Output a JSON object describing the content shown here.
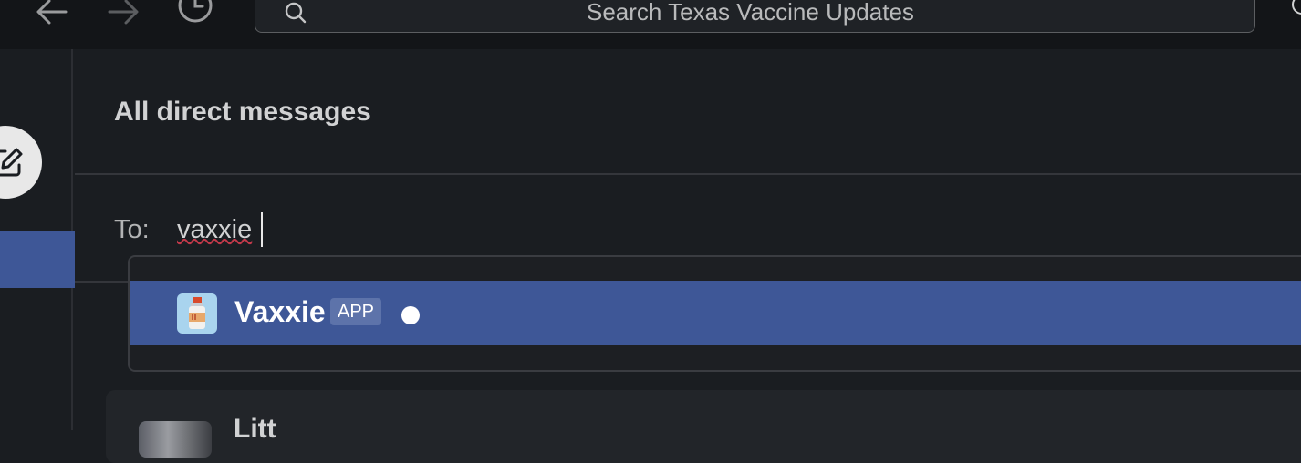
{
  "search": {
    "placeholder": "Search Texas Vaccine Updates"
  },
  "page": {
    "title": "All direct messages"
  },
  "compose": {
    "to_label": "To:",
    "to_value": "vaxxie"
  },
  "suggestions": [
    {
      "name": "Vaxxie",
      "badge": "APP",
      "status": "active"
    }
  ],
  "card": {
    "name_partial": "Litt"
  },
  "colors": {
    "accent": "#3e5797",
    "background": "#1a1d21",
    "topbar": "#131518",
    "badge": "#5d73aa"
  }
}
